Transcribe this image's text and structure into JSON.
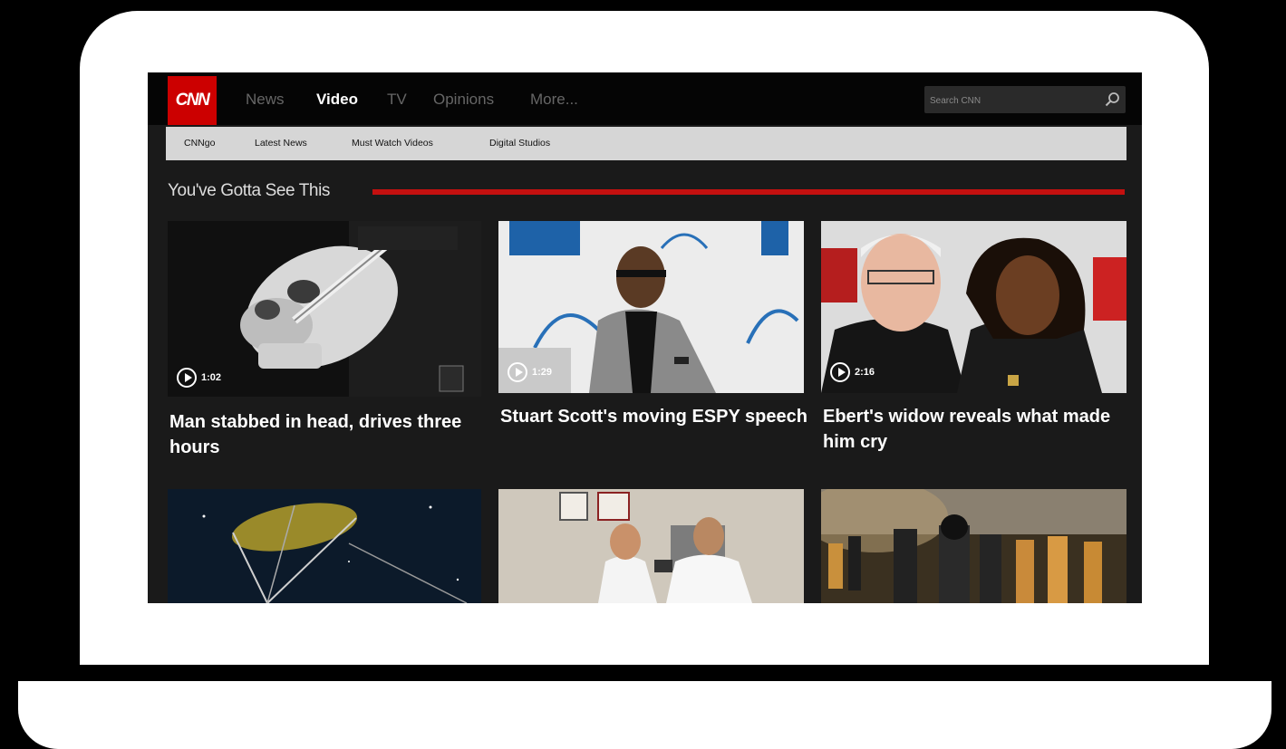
{
  "header": {
    "logo_text": "CNN",
    "nav": [
      "News",
      "Video",
      "TV",
      "Opinions",
      "More..."
    ],
    "active_nav": "Video",
    "search_placeholder": "Search CNN"
  },
  "subnav": [
    "CNNgo",
    "Latest News",
    "Must Watch Videos",
    "Digital Studios"
  ],
  "section": {
    "title": "You've Gotta See This"
  },
  "cards": [
    {
      "duration": "1:02",
      "title": "Man stabbed in head, drives three hours"
    },
    {
      "duration": "1:29",
      "title": "Stuart Scott's moving ESPY speech"
    },
    {
      "duration": "2:16",
      "title": "Ebert's widow reveals what made him cry"
    }
  ],
  "icons": {
    "logo": "cnn-logo",
    "search": "search-icon",
    "play": "play-icon"
  },
  "colors": {
    "brand_red": "#cc0000",
    "background": "#1a1a1a",
    "subnav_bg": "#d6d6d6"
  }
}
